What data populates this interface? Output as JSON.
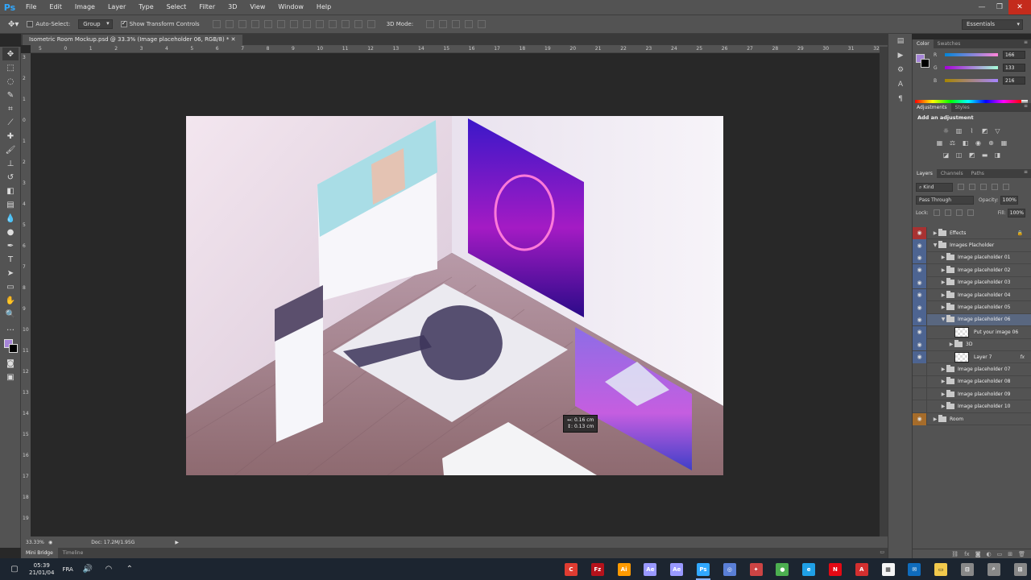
{
  "app": {
    "logo": "Ps"
  },
  "menu": [
    "File",
    "Edit",
    "Image",
    "Layer",
    "Type",
    "Select",
    "Filter",
    "3D",
    "View",
    "Window",
    "Help"
  ],
  "window_controls": {
    "minimize": "—",
    "restore": "❐",
    "close": "✕"
  },
  "options": {
    "auto_select_label": "Auto-Select:",
    "group_value": "Group",
    "show_transform_label": "Show Transform Controls",
    "mode_3d_label": "3D Mode:",
    "workspace": "Essentials"
  },
  "document": {
    "tab_title": "Isometric Room Mockup.psd @ 33.3% (Image placeholder 06, RGB/8) *",
    "zoom": "33.33%",
    "doc_info": "Doc: 17.2M/1.95G",
    "ruler_h": [
      "5",
      "0",
      "1",
      "2",
      "3",
      "4",
      "5",
      "6",
      "7",
      "8",
      "9",
      "10",
      "11",
      "12",
      "13",
      "14",
      "15",
      "16",
      "17",
      "18",
      "19",
      "20",
      "21",
      "22",
      "23",
      "24",
      "25",
      "26",
      "27",
      "28",
      "29",
      "30",
      "31",
      "32"
    ],
    "ruler_v": [
      "3",
      "2",
      "1",
      "0",
      "1",
      "2",
      "3",
      "4",
      "5",
      "6",
      "7",
      "8",
      "9",
      "10",
      "11",
      "12",
      "13",
      "14",
      "15",
      "16",
      "17",
      "18",
      "19",
      "20",
      "21",
      "22"
    ],
    "cursor_tip": {
      "line1": "↔: 0.16 cm",
      "line2": "↕: 0.13 cm"
    }
  },
  "bottom_tabs": [
    "Mini Bridge",
    "Timeline"
  ],
  "color_panel": {
    "tabs": [
      "Color",
      "Swatches"
    ],
    "r_label": "R",
    "g_label": "G",
    "b_label": "B",
    "r": "166",
    "g": "133",
    "b": "216",
    "fg_color": "#a685d8"
  },
  "adjustments": {
    "tabs": [
      "Adjustments",
      "Styles"
    ],
    "title": "Add an adjustment"
  },
  "layers_panel": {
    "tabs": [
      "Layers",
      "Channels",
      "Paths"
    ],
    "kind": "Kind",
    "blend_mode": "Pass Through",
    "opacity_label": "Opacity:",
    "opacity": "100%",
    "lock_label": "Lock:",
    "fill_label": "Fill:",
    "fill": "100%"
  },
  "layers": [
    {
      "name": "Effects",
      "indent": 0,
      "type": "folder",
      "eye": "red",
      "arrow": "▶",
      "lock": "🔒"
    },
    {
      "name": "Images Placholder",
      "indent": 0,
      "type": "folder",
      "eye": "blue",
      "arrow": "▼"
    },
    {
      "name": "Image placeholder 01",
      "indent": 1,
      "type": "folder",
      "eye": "blue",
      "arrow": "▶"
    },
    {
      "name": "Image placeholder 02",
      "indent": 1,
      "type": "folder",
      "eye": "blue",
      "arrow": "▶"
    },
    {
      "name": "Image placeholder 03",
      "indent": 1,
      "type": "folder",
      "eye": "blue",
      "arrow": "▶"
    },
    {
      "name": "Image placeholder 04",
      "indent": 1,
      "type": "folder",
      "eye": "blue",
      "arrow": "▶"
    },
    {
      "name": "Image placeholder 05",
      "indent": 1,
      "type": "folder",
      "eye": "blue",
      "arrow": "▶"
    },
    {
      "name": "Image placeholder 06",
      "indent": 1,
      "type": "folder",
      "eye": "blue",
      "arrow": "▼",
      "selected": true
    },
    {
      "name": "Put your image 06",
      "indent": 2,
      "type": "thumb",
      "eye": "blue",
      "arrow": ""
    },
    {
      "name": "3D",
      "indent": 2,
      "type": "folder",
      "eye": "blue",
      "arrow": "▶"
    },
    {
      "name": "Layer 7",
      "indent": 2,
      "type": "thumb",
      "eye": "blue",
      "arrow": "",
      "fx": "fx"
    },
    {
      "name": "Image placeholder 07",
      "indent": 1,
      "type": "folder",
      "eye": "off",
      "arrow": "▶"
    },
    {
      "name": "Image placeholder 08",
      "indent": 1,
      "type": "folder",
      "eye": "off",
      "arrow": "▶"
    },
    {
      "name": "Image placeholder 09",
      "indent": 1,
      "type": "folder",
      "eye": "off",
      "arrow": "▶"
    },
    {
      "name": "Image placeholder 10",
      "indent": 1,
      "type": "folder",
      "eye": "off",
      "arrow": "▶"
    },
    {
      "name": "Room",
      "indent": 0,
      "type": "folder",
      "eye": "orange",
      "arrow": "▶"
    }
  ],
  "taskbar": {
    "time": "05:39",
    "date": "21/01/04",
    "lang": "FRA",
    "apps": [
      {
        "label": "C",
        "color": "#e03c31"
      },
      {
        "label": "Fz",
        "color": "#b5121b"
      },
      {
        "label": "Ai",
        "color": "#ff9a00"
      },
      {
        "label": "Ae",
        "color": "#9999ff"
      },
      {
        "label": "Ae",
        "color": "#9999ff"
      },
      {
        "label": "Ps",
        "color": "#31a8ff",
        "active": true
      },
      {
        "label": "◎",
        "color": "#5a7fd6"
      },
      {
        "label": "✦",
        "color": "#c44"
      },
      {
        "label": "●",
        "color": "#4caf50"
      },
      {
        "label": "e",
        "color": "#1fa0e6"
      },
      {
        "label": "N",
        "color": "#e50914"
      },
      {
        "label": "A",
        "color": "#d32f2f"
      },
      {
        "label": "▦",
        "color": "#f5f5f5"
      },
      {
        "label": "✉",
        "color": "#0f6cbd"
      },
      {
        "label": "▭",
        "color": "#f2c94c"
      },
      {
        "label": "⊟",
        "color": "#888"
      },
      {
        "label": "⌕",
        "color": "#888"
      },
      {
        "label": "⊞",
        "color": "#888"
      }
    ]
  }
}
